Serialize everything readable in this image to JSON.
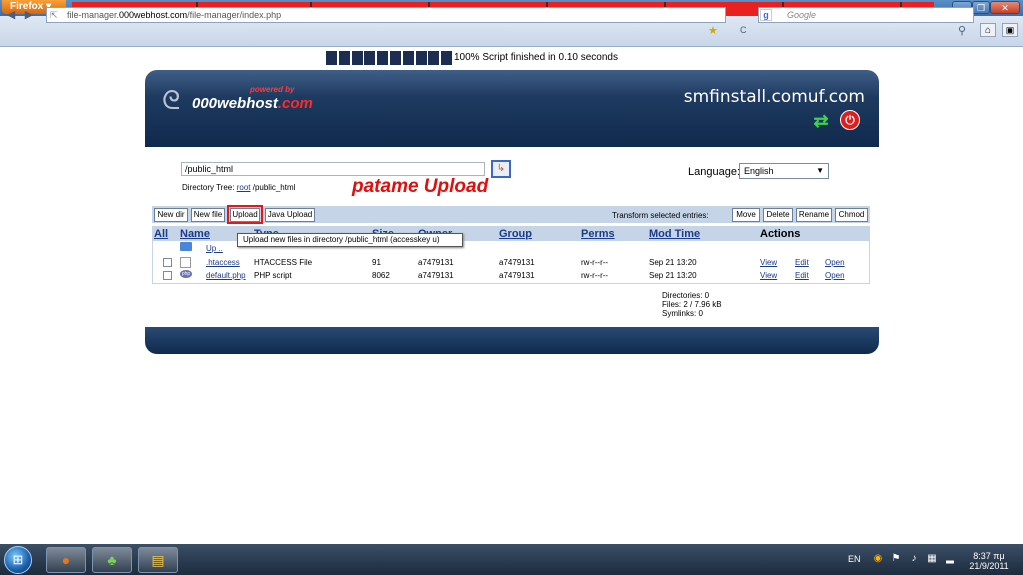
{
  "browser": {
    "menu_label": "Firefox",
    "url_prefix": "file-manager.",
    "url_domain": "000webhost.com",
    "url_path": "/file-manager/index.php",
    "search_placeholder": "Google"
  },
  "progress": {
    "percent": 100,
    "text": "100% Script finished in 0.10 seconds"
  },
  "header": {
    "logo_by": "powered by",
    "logo_name": "000webhost",
    "logo_tld": ".com",
    "site_name": "smfinstall.comuf.com"
  },
  "path": {
    "value": "/public_html",
    "tree_label": "Directory Tree:",
    "tree_root": "root",
    "tree_rest": "/public_html"
  },
  "annotation": "patame Upload",
  "language": {
    "label": "Language:",
    "selected": "English"
  },
  "toolbar": {
    "new_dir": "New dir",
    "new_file": "New file",
    "upload": "Upload",
    "java_upload": "Java Upload",
    "transform_label": "Transform selected entries:",
    "move": "Move",
    "delete": "Delete",
    "rename": "Rename",
    "chmod": "Chmod"
  },
  "tooltip": "Upload new files in directory /public_html (accesskey u)",
  "table": {
    "headers": {
      "all": "All",
      "name": "Name",
      "type": "Type",
      "size": "Size",
      "owner": "Owner",
      "group": "Group",
      "perms": "Perms",
      "mod_time": "Mod Time",
      "actions": "Actions"
    },
    "up_label": "Up ..",
    "rows": [
      {
        "name": ".htaccess",
        "type": "HTACCESS File",
        "size": "91",
        "owner": "a7479131",
        "group": "a7479131",
        "perms": "rw-r--r--",
        "mod_time": "Sep 21 13:20",
        "view": "View",
        "edit": "Edit",
        "open": "Open"
      },
      {
        "name": "default.php",
        "type": "PHP script",
        "size": "8062",
        "owner": "a7479131",
        "group": "a7479131",
        "perms": "rw-r--r--",
        "mod_time": "Sep 21 13:20",
        "view": "View",
        "edit": "Edit",
        "open": "Open"
      }
    ]
  },
  "stats": {
    "directories": "Directories: 0",
    "files": "Files: 2 / 7.96 kB",
    "symlinks": "Symlinks: 0"
  },
  "taskbar": {
    "lang": "EN",
    "time": "8:37 πμ",
    "date": "21/9/2011"
  }
}
